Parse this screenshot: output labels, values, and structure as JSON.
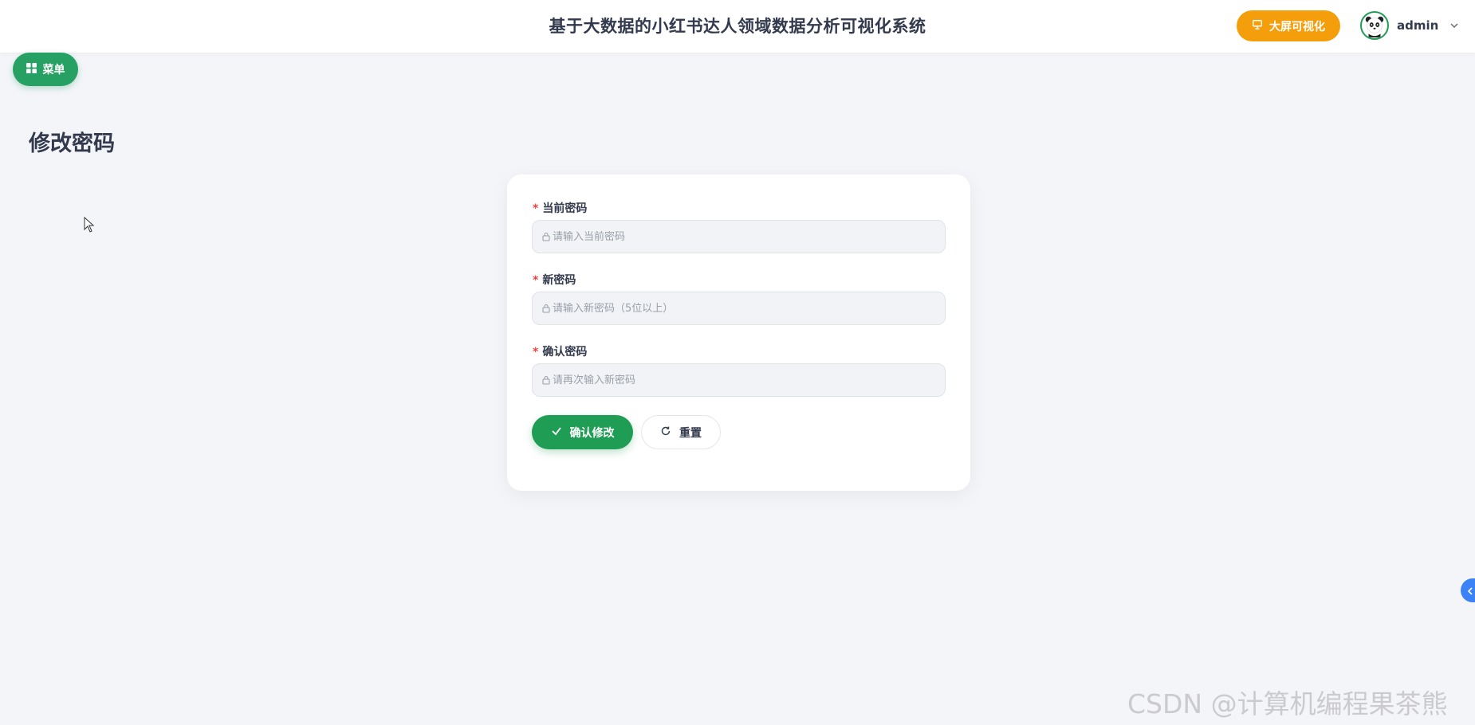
{
  "header": {
    "title": "基于大数据的小红书达人领域数据分析可视化系统",
    "bigscreen_label": "大屏可视化",
    "username": "admin"
  },
  "menu_button": {
    "label": "菜单"
  },
  "page": {
    "title": "修改密码"
  },
  "form": {
    "fields": [
      {
        "label": "当前密码",
        "placeholder": "请输入当前密码",
        "required": true
      },
      {
        "label": "新密码",
        "placeholder": "请输入新密码（5位以上）",
        "required": true
      },
      {
        "label": "确认密码",
        "placeholder": "请再次输入新密码",
        "required": true
      }
    ],
    "required_mark": "*",
    "confirm_label": "确认修改",
    "reset_label": "重置"
  },
  "watermark": "CSDN @计算机编程果茶熊",
  "icons": {
    "bigscreen": "presentation-icon",
    "menu": "grid-icon",
    "field": "lock-icon",
    "confirm": "check-icon",
    "reset": "refresh-icon",
    "dropdown": "chevron-down-icon",
    "side_toggle": "chevron-left-icon"
  },
  "colors": {
    "primary_green": "#1f9d55",
    "menu_green": "#27a064",
    "accent_orange": "#f59e0b",
    "required_red": "#f04040",
    "side_blue": "#3b82f6"
  }
}
